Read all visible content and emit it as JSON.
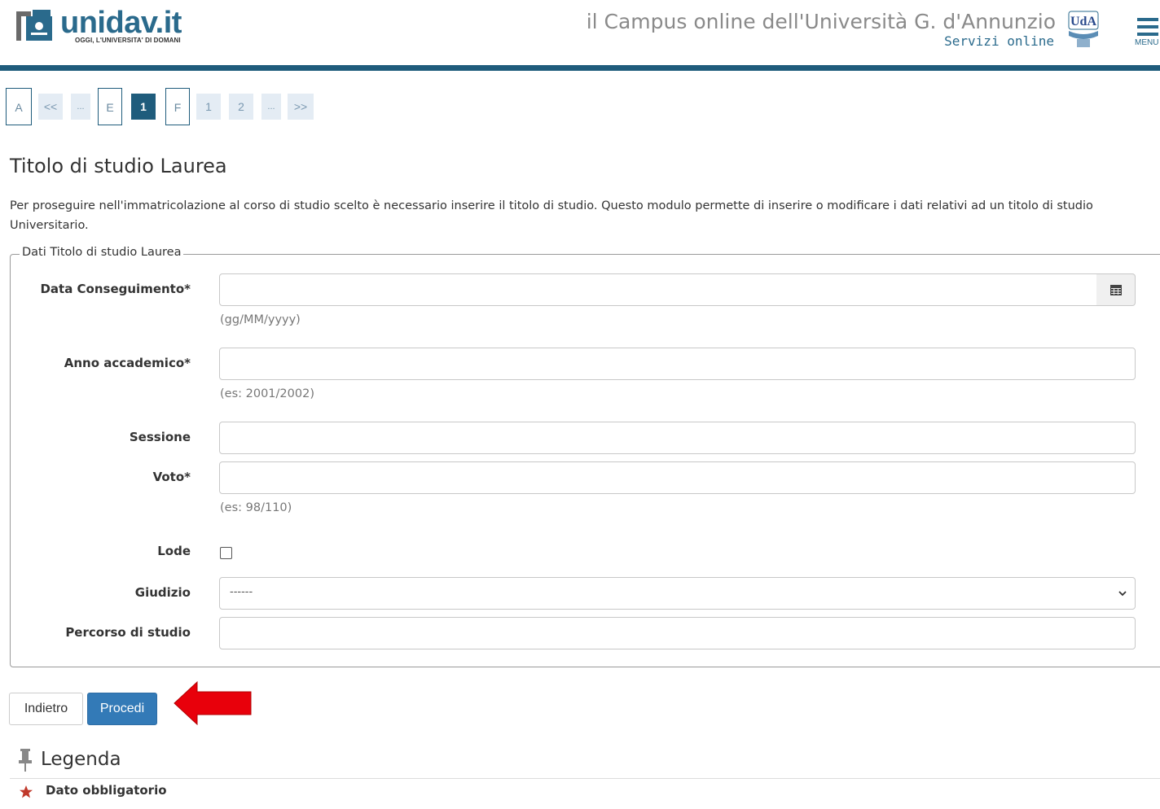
{
  "header": {
    "logo_text": "unidav.it",
    "logo_tagline": "OGGI, L'UNIVERSITA' DI DOMANI",
    "campus_title": "il Campus online dell'Università G. d'Annunzio",
    "campus_subtitle": "Servizi online",
    "uda_logo_text": "UdA",
    "menu_label": "MENU",
    "menu_icon": "hamburger-icon",
    "bar_color": "#1f5c7c"
  },
  "steps": [
    "A",
    "<<",
    "...",
    "E",
    "1",
    "F",
    "1",
    "2",
    "...",
    ">>"
  ],
  "page": {
    "title": "Titolo di studio Laurea",
    "intro": "Per proseguire nell'immatricolazione al corso di studio scelto è necessario inserire il titolo di studio. Questo modulo permette di inserire o modificare i dati relativi ad un titolo di studio Universitario."
  },
  "form": {
    "legend": "Dati Titolo di studio Laurea",
    "data_conseguimento": {
      "label": "Data Conseguimento*",
      "value": "",
      "hint": "(gg/MM/yyyy)",
      "icon": "calendar-icon"
    },
    "anno_accademico": {
      "label": "Anno accademico*",
      "value": "",
      "hint": "(es: 2001/2002)"
    },
    "sessione": {
      "label": "Sessione",
      "value": ""
    },
    "voto": {
      "label": "Voto*",
      "value": "",
      "hint": "(es: 98/110)"
    },
    "lode": {
      "label": "Lode",
      "checked": false
    },
    "giudizio": {
      "label": "Giudizio",
      "selected": "------"
    },
    "percorso": {
      "label": "Percorso di studio",
      "value": ""
    }
  },
  "buttons": {
    "back": "Indietro",
    "next": "Procedi",
    "next_color": "#337ab7"
  },
  "annotation": {
    "icon": "red-arrow-icon",
    "color": "#e8000b"
  },
  "legend": {
    "title": "Legenda",
    "icon": "pin-icon",
    "items": [
      {
        "icon": "star-icon",
        "label": "Dato obbligatorio"
      }
    ]
  }
}
